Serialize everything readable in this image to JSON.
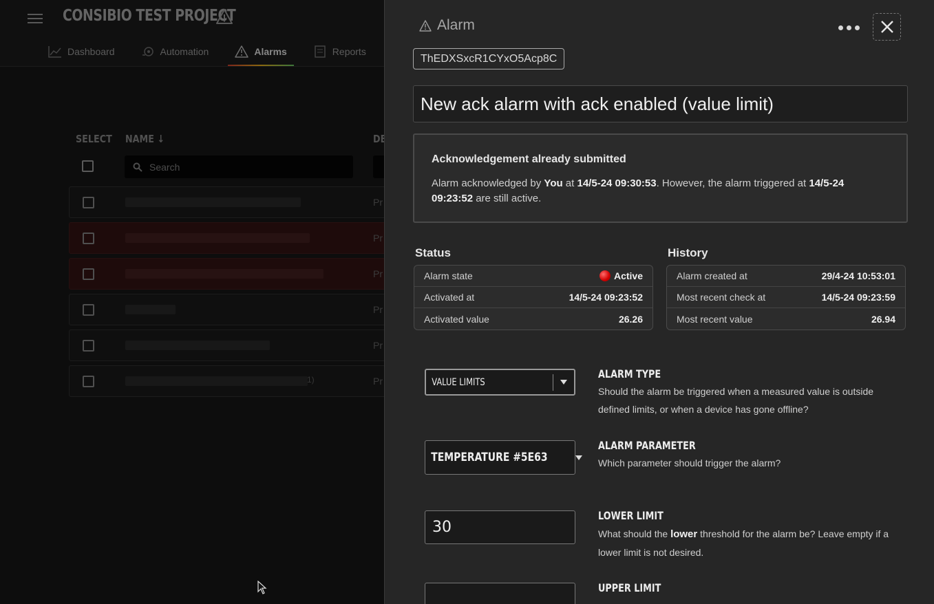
{
  "app": {
    "project_title": "CONSIBIO TEST PROJECT",
    "tabs": [
      {
        "label": "Dashboard",
        "icon": "chart-icon"
      },
      {
        "label": "Automation",
        "icon": "automation-icon"
      },
      {
        "label": "Alarms",
        "icon": "warning-icon"
      },
      {
        "label": "Reports",
        "icon": "report-icon"
      }
    ],
    "active_tab": "Alarms",
    "table": {
      "col_select": "SELECT",
      "col_name": "NAME ↓",
      "col_desc": "DE",
      "search_placeholder": "Search",
      "row_prefix": "Pr",
      "row_note": "1)"
    },
    "colors": {
      "accent_red": "#c0392b",
      "accent_yellow": "#d4a017",
      "accent_green": "#5cb85c"
    }
  },
  "drawer": {
    "title": "Alarm",
    "alarm_id": "ThEDXSxcR1CYxO5Acp8C",
    "alarm_name": "New ack alarm with ack enabled (value limit)",
    "ack": {
      "title": "Acknowledgement already submitted",
      "p1": "Alarm acknowledged by ",
      "who": "You",
      "p2": " at ",
      "ack_time": "14/5-24 09:30:53",
      "p3": ". However, the alarm triggered at ",
      "trigger_time": "14/5-24 09:23:52",
      "p4": " are still active."
    },
    "status": {
      "title": "Status",
      "rows": [
        {
          "key": "Alarm state",
          "value": "Active"
        },
        {
          "key": "Activated at",
          "value": "14/5-24 09:23:52"
        },
        {
          "key": "Activated value",
          "value": "26.26"
        }
      ]
    },
    "history": {
      "title": "History",
      "rows": [
        {
          "key": "Alarm created at",
          "value": "29/4-24 10:53:01"
        },
        {
          "key": "Most recent check at",
          "value": "14/5-24 09:23:59"
        },
        {
          "key": "Most recent value",
          "value": "26.94"
        }
      ]
    },
    "alarm_type": {
      "value": "VALUE LIMITS",
      "title": "ALARM TYPE",
      "desc": "Should the alarm be triggered when a measured value is outside defined limits, or when a device has gone offline?"
    },
    "alarm_parameter": {
      "value": "TEMPERATURE #5E63",
      "title": "ALARM PARAMETER",
      "desc": "Which parameter should trigger the alarm?"
    },
    "lower_limit": {
      "value": "30",
      "title": "LOWER LIMIT",
      "d1": "What should the ",
      "em": "lower",
      "d2": " threshold for the alarm be? Leave empty if a lower limit is not desired."
    },
    "upper_limit": {
      "value": "",
      "title": "UPPER LIMIT"
    }
  }
}
